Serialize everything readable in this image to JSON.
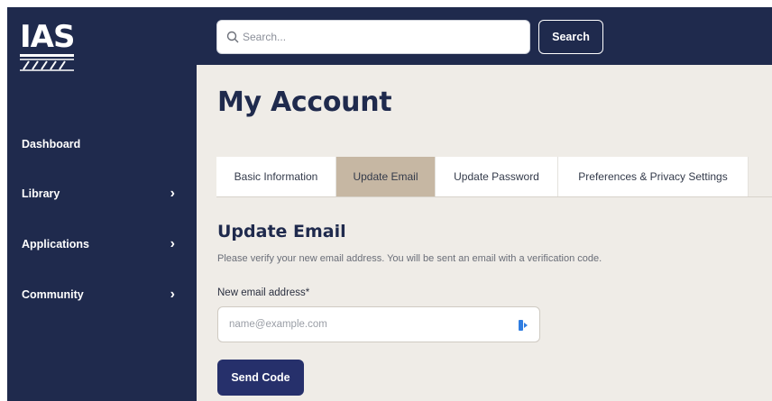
{
  "brand": {
    "logo_text": "IAS"
  },
  "sidebar": {
    "items": [
      {
        "label": "Dashboard",
        "has_submenu": false
      },
      {
        "label": "Library",
        "has_submenu": true
      },
      {
        "label": "Applications",
        "has_submenu": true
      },
      {
        "label": "Community",
        "has_submenu": true
      }
    ],
    "chevron": "›"
  },
  "header": {
    "search_placeholder": "Search...",
    "search_button_label": "Search"
  },
  "page": {
    "title": "My Account",
    "tabs": [
      {
        "label": "Basic Information",
        "active": false
      },
      {
        "label": "Update Email",
        "active": true
      },
      {
        "label": "Update Password",
        "active": false
      },
      {
        "label": "Preferences & Privacy Settings",
        "active": false
      }
    ]
  },
  "form": {
    "title": "Update Email",
    "description": "Please verify your new email address. You will be sent an email with a verification code.",
    "field_label": "New email address*",
    "email_placeholder": "name@example.com",
    "email_value": "",
    "submit_label": "Send Code"
  },
  "colors": {
    "navy": "#1f2a4d",
    "page_bg": "#efece7",
    "active_tab": "#c6b7a3",
    "primary_button": "#26306b"
  },
  "icons": [
    "search-icon",
    "chevron-right-icon",
    "autofill-icon"
  ]
}
